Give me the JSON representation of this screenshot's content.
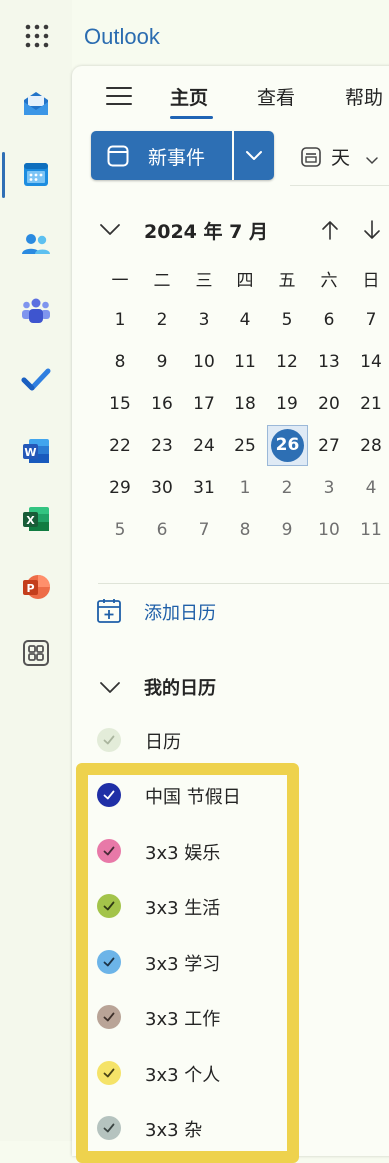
{
  "app": {
    "title": "Outlook"
  },
  "rail": {
    "items": [
      {
        "name": "mail",
        "color": "#1b6ec2"
      },
      {
        "name": "calendar",
        "color": "#1690d6",
        "active": true
      },
      {
        "name": "people",
        "color": "#3aa0e0"
      },
      {
        "name": "teams",
        "color": "#4a6fd8"
      },
      {
        "name": "todo",
        "color": "#2f7fe0"
      },
      {
        "name": "word",
        "color": "#2b5cb8"
      },
      {
        "name": "excel",
        "color": "#1f7a45"
      },
      {
        "name": "powerpoint",
        "color": "#c94a2c"
      },
      {
        "name": "more-apps",
        "color": "#555555"
      }
    ]
  },
  "ribbon": {
    "tabs": [
      {
        "label": "主页",
        "active": true
      },
      {
        "label": "查看"
      },
      {
        "label": "帮助"
      }
    ],
    "new_event_label": "新事件",
    "view_label": "天"
  },
  "mini_calendar": {
    "title": "2024 年 7 月",
    "weekdays": [
      "一",
      "二",
      "三",
      "四",
      "五",
      "六",
      "日"
    ],
    "weeks": [
      [
        {
          "d": "1"
        },
        {
          "d": "2"
        },
        {
          "d": "3"
        },
        {
          "d": "4"
        },
        {
          "d": "5"
        },
        {
          "d": "6"
        },
        {
          "d": "7"
        }
      ],
      [
        {
          "d": "8"
        },
        {
          "d": "9"
        },
        {
          "d": "10"
        },
        {
          "d": "11"
        },
        {
          "d": "12"
        },
        {
          "d": "13"
        },
        {
          "d": "14"
        }
      ],
      [
        {
          "d": "15"
        },
        {
          "d": "16"
        },
        {
          "d": "17"
        },
        {
          "d": "18"
        },
        {
          "d": "19"
        },
        {
          "d": "20"
        },
        {
          "d": "21"
        }
      ],
      [
        {
          "d": "22"
        },
        {
          "d": "23"
        },
        {
          "d": "24"
        },
        {
          "d": "25"
        },
        {
          "d": "26",
          "today": true
        },
        {
          "d": "27"
        },
        {
          "d": "28"
        }
      ],
      [
        {
          "d": "29"
        },
        {
          "d": "30"
        },
        {
          "d": "31"
        },
        {
          "d": "1",
          "dim": true
        },
        {
          "d": "2",
          "dim": true
        },
        {
          "d": "3",
          "dim": true
        },
        {
          "d": "4",
          "dim": true
        }
      ],
      [
        {
          "d": "5",
          "dim": true
        },
        {
          "d": "6",
          "dim": true
        },
        {
          "d": "7",
          "dim": true
        },
        {
          "d": "8",
          "dim": true
        },
        {
          "d": "9",
          "dim": true
        },
        {
          "d": "10",
          "dim": true
        },
        {
          "d": "11",
          "dim": true
        }
      ]
    ]
  },
  "add_calendar_label": "添加日历",
  "my_calendars": {
    "header": "我的日历",
    "items": [
      {
        "label": "日历",
        "color": "#e3ecd9",
        "check": "#aab59e"
      },
      {
        "label": "中国 节假日",
        "color": "#1f2fa6",
        "check": "#ffffff"
      },
      {
        "label": "3x3 娱乐",
        "color": "#e879a8",
        "check": "#4a2a38"
      },
      {
        "label": "3x3 生活",
        "color": "#a3c44a",
        "check": "#2f3a15"
      },
      {
        "label": "3x3 学习",
        "color": "#6cb4e8",
        "check": "#1d3347"
      },
      {
        "label": "3x3 工作",
        "color": "#b9a497",
        "check": "#3d302a"
      },
      {
        "label": "3x3 个人",
        "color": "#f5e368",
        "check": "#4a4416"
      },
      {
        "label": "3x3 杂",
        "color": "#b5c3bf",
        "check": "#3a4442"
      }
    ]
  },
  "highlight_color": "#eed24d"
}
